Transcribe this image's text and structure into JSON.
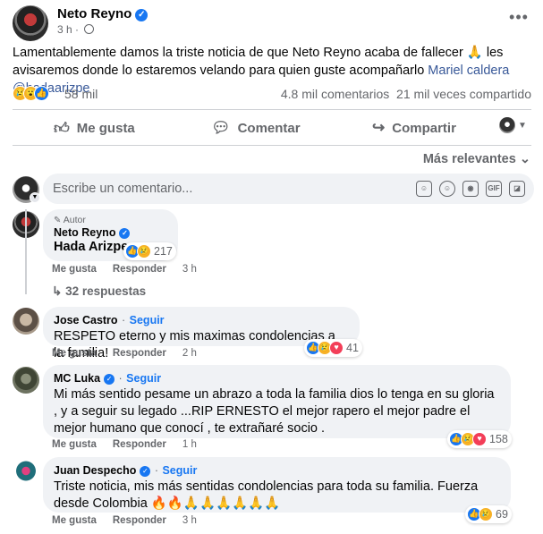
{
  "post": {
    "author": "Neto Reyno",
    "time": "3 h",
    "separator": "·",
    "text_before": "Lamentablemente damos la triste noticia de que Neto Reyno acaba de fallecer 🙏 les avisaremos donde lo estaremos velando para quien guste acompañarlo ",
    "mention1": "Mariel caldera",
    "mention2": " @hadaarizpe",
    "reactions_count": "58 mil",
    "comments_count": "4.8 mil comentarios",
    "shares_count": "21 mil veces compartido",
    "more_glyph": "•••"
  },
  "actions": {
    "like": "Me gusta",
    "comment": "Comentar",
    "share": "Compartir"
  },
  "sort_label": "Más relevantes",
  "composer": {
    "placeholder": "Escribe un comentario...",
    "gif_label": "GIF"
  },
  "comments": [
    {
      "badge": "Autor",
      "author": "Neto Reyno",
      "text": "Hada Arizpe",
      "reactions": "217",
      "like": "Me gusta",
      "reply": "Responder",
      "time": "3 h",
      "replies": "32 respuestas"
    },
    {
      "author": "Jose Castro",
      "follow": "Seguir",
      "text": "RESPETO eterno y mis maximas condolencias a la familia!",
      "reactions": "41",
      "like": "Me gusta",
      "reply": "Responder",
      "time": "2 h"
    },
    {
      "author": "MC Luka",
      "follow": "Seguir",
      "text": "Mi más sentido pesame un abrazo a toda la familia dios lo tenga en su gloria , y a seguir su legado ...RIP ERNESTO el mejor rapero el mejor padre el mejor humano que conocí , te extrañaré socio .",
      "reactions": "158",
      "like": "Me gusta",
      "reply": "Responder",
      "time": "1 h"
    },
    {
      "author": "Juan Despecho",
      "follow": "Seguir",
      "text": "Triste noticia, mis más sentidas condolencias para toda su familia. Fuerza desde Colombia 🔥🔥🙏🙏🙏🙏🙏🙏",
      "reactions": "69",
      "like": "Me gusta",
      "reply": "Responder",
      "time": "3 h"
    }
  ],
  "colors": {
    "accent": "#1877f2",
    "text_secondary": "#65676b",
    "bubble": "#f0f2f5"
  }
}
